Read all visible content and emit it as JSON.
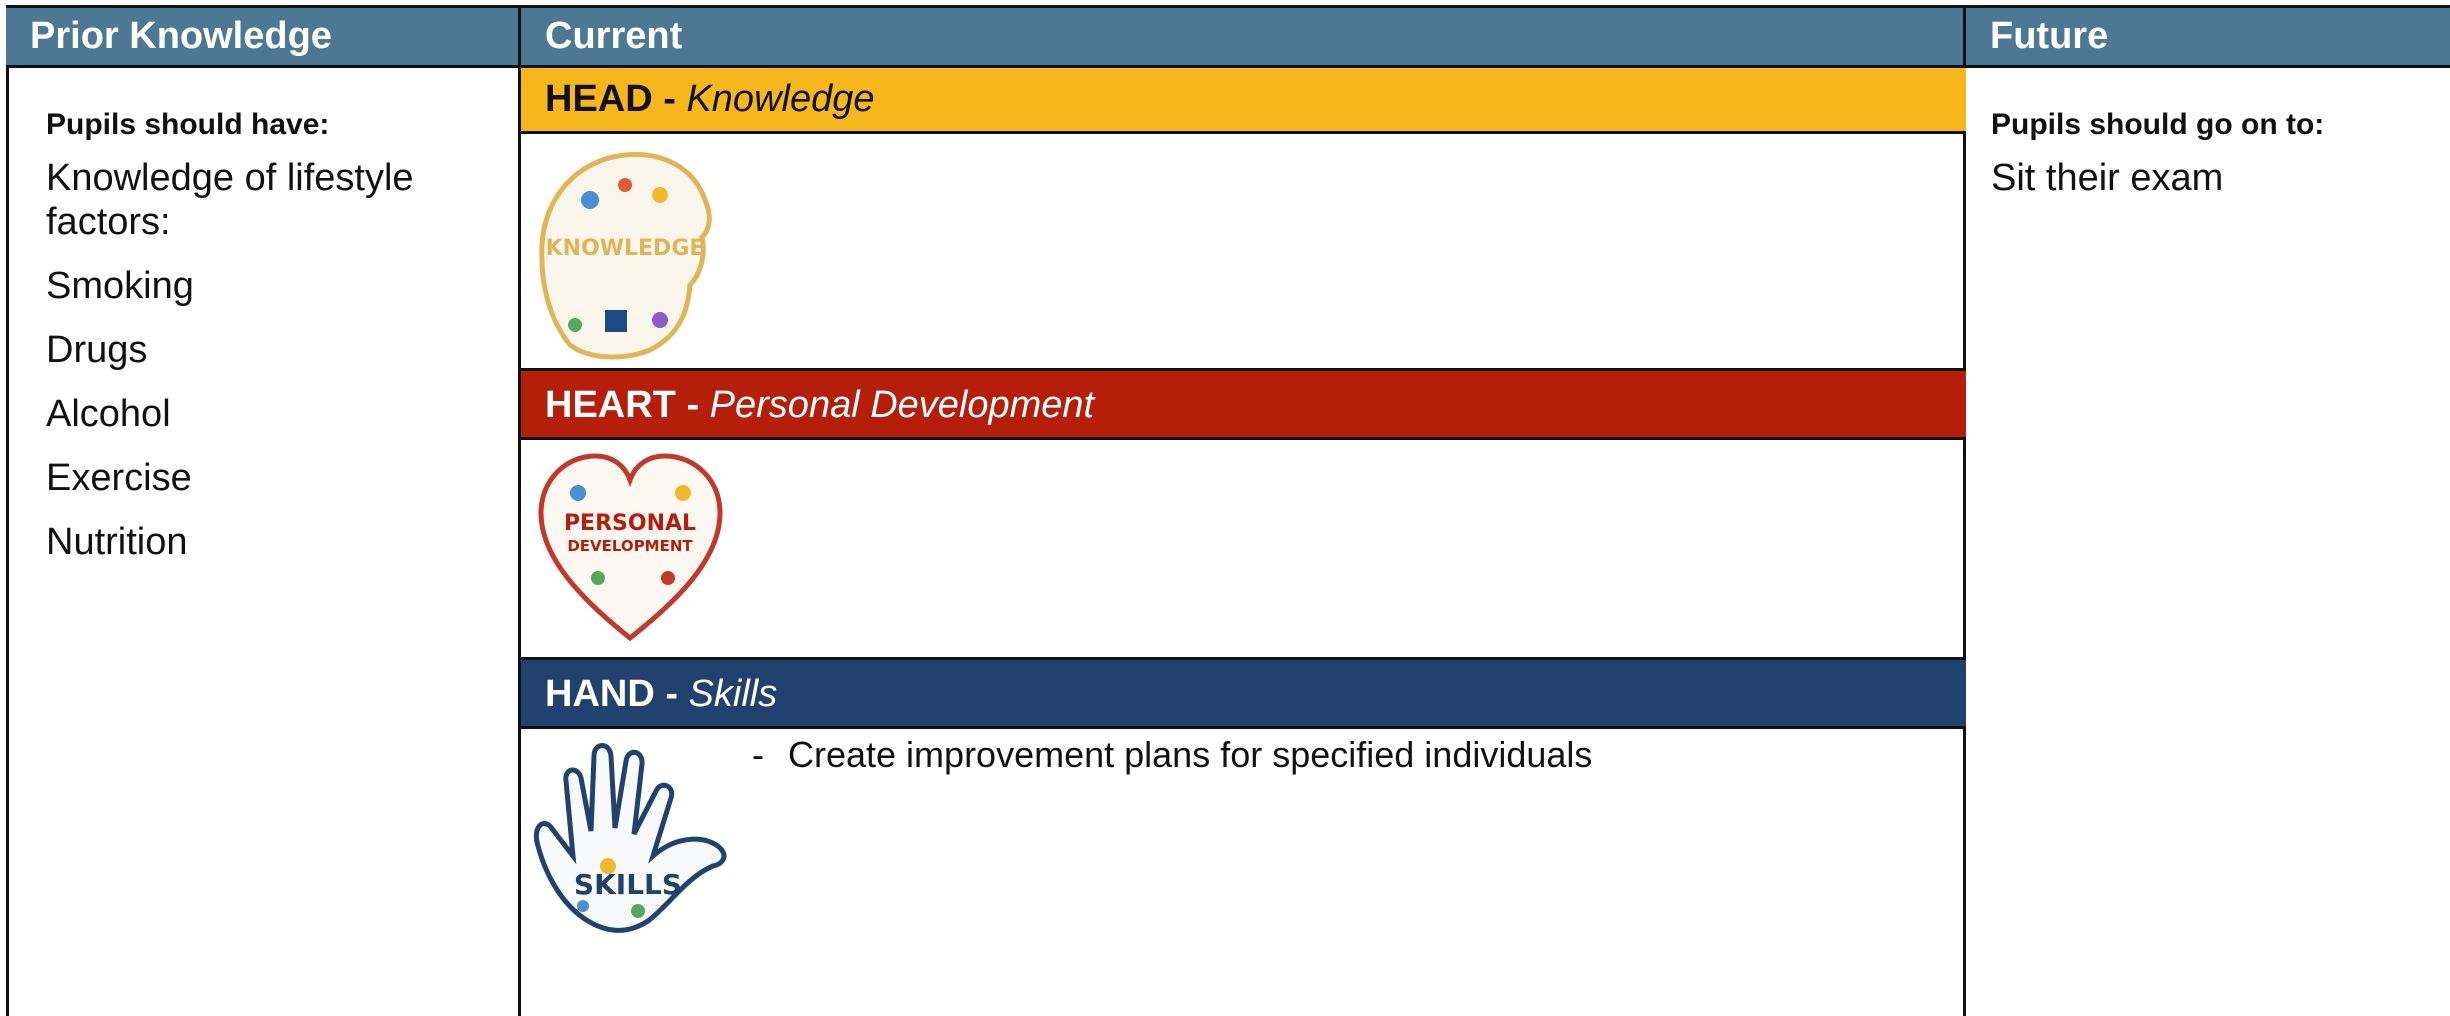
{
  "headers": {
    "prior": "Prior Knowledge",
    "current": "Current",
    "future": "Future"
  },
  "prior": {
    "subhead": "Pupils should have:",
    "items": [
      "Knowledge of lifestyle factors:",
      "Smoking",
      "Drugs",
      "Alcohol",
      "Exercise",
      "Nutrition"
    ]
  },
  "current": {
    "head": {
      "label": "HEAD -",
      "sub": "Knowledge",
      "image_text": "KNOWLEDGE"
    },
    "heart": {
      "label": "HEART -",
      "sub": "Personal Development",
      "image_text_1": "PERSONAL",
      "image_text_2": "DEVELOPMENT"
    },
    "hand": {
      "label": "HAND -",
      "sub": "Skills",
      "image_text": "SKILLS",
      "bullets": [
        "Create improvement plans for specified individuals"
      ]
    }
  },
  "future": {
    "subhead": "Pupils should go on to:",
    "items": [
      "Sit their exam"
    ]
  },
  "colors": {
    "header": "#4d7893",
    "head_band": "#f5b71c",
    "heart_band": "#b41e0b",
    "hand_band": "#21426f"
  },
  "icons": [
    "head-knowledge-icon",
    "heart-personal-development-icon",
    "hand-skills-icon"
  ]
}
